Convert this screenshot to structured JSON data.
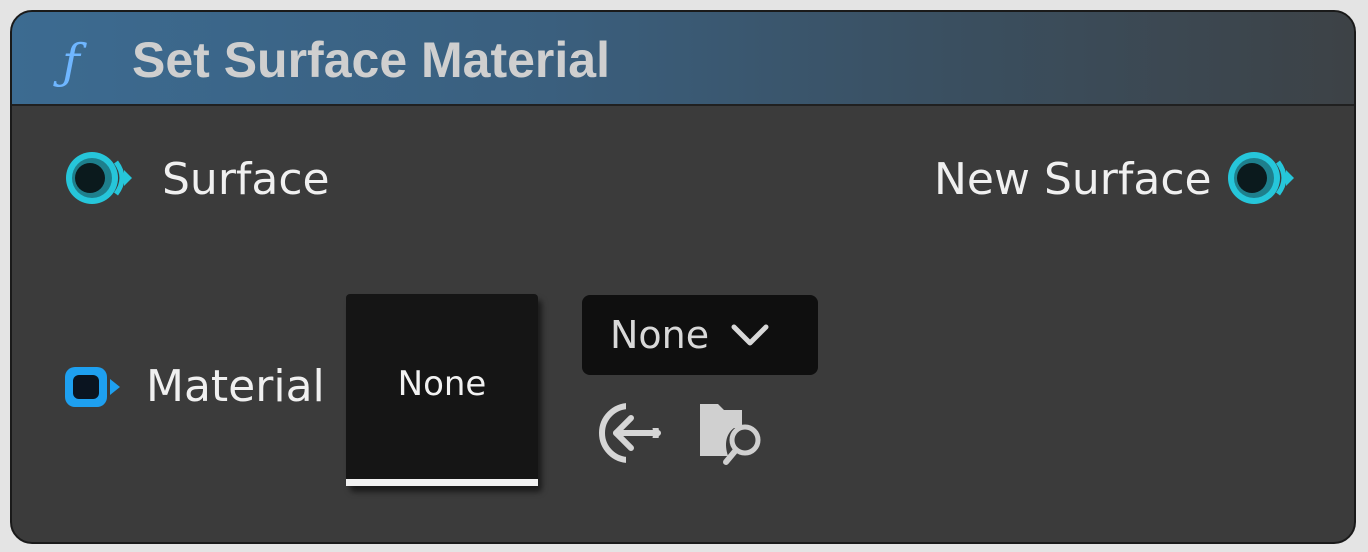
{
  "node": {
    "icon": "function-icon",
    "icon_glyph": "ƒ",
    "title": "Set Surface Material",
    "header_color": "#3c6b91",
    "accent_struct": "#26c6da",
    "accent_object": "#1ea0f0"
  },
  "inputs": {
    "surface_label": "Surface",
    "material_label": "Material"
  },
  "outputs": {
    "new_surface_label": "New Surface"
  },
  "material_picker": {
    "thumbnail_text": "None",
    "selected_value": "None",
    "use_selected_icon": "arrow-left-circle-icon",
    "browse_icon": "folder-search-icon"
  }
}
